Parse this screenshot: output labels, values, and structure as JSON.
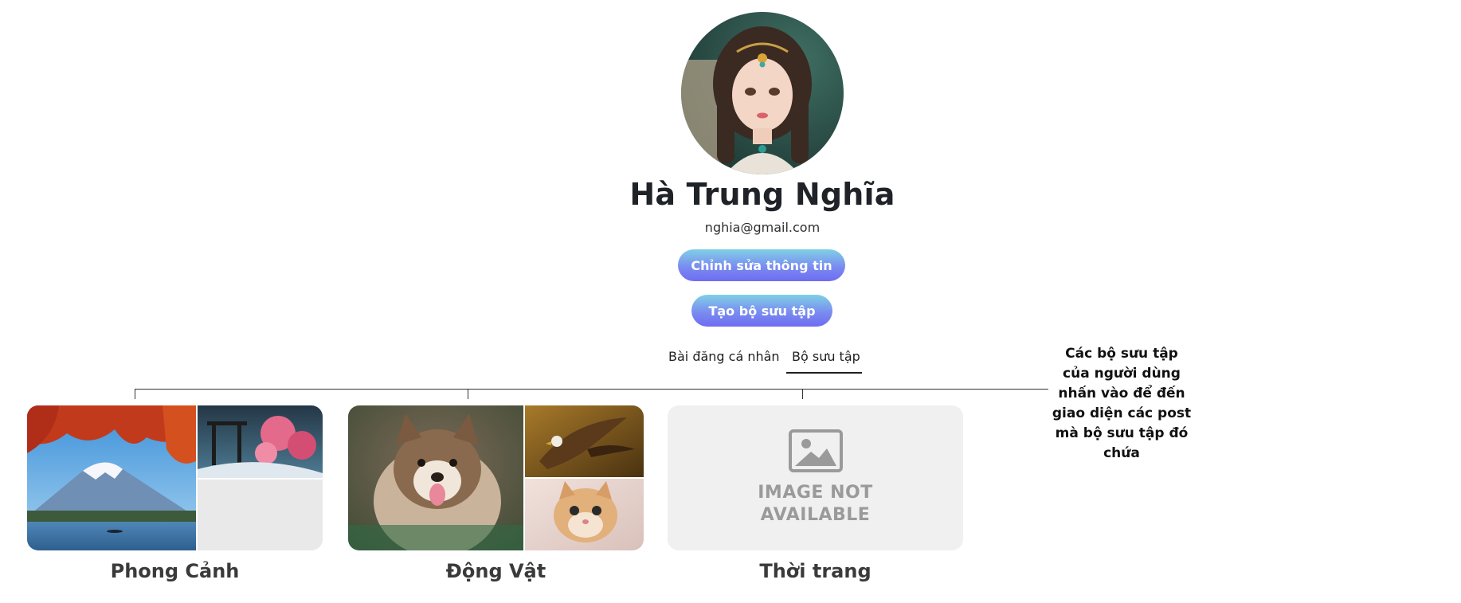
{
  "profile": {
    "name": "Hà Trung Nghĩa",
    "email": "nghia@gmail.com",
    "avatar_icon": "avatar-portrait"
  },
  "actions": {
    "edit_label": "Chỉnh sửa thông tin",
    "create_label": "Tạo bộ sưu tập"
  },
  "tabs": [
    {
      "label": "Bài đăng cá nhân",
      "active": false
    },
    {
      "label": "Bộ sưu tập",
      "active": true
    }
  ],
  "annotation": "Các bộ sưu tập của người dùng nhấn vào để đến giao diện các post mà bộ sưu tập đó chứa",
  "collections": [
    {
      "title": "Phong Cảnh",
      "thumbnails": [
        "mountain-autumn-photo",
        "torii-blossom-photo",
        "empty-slot"
      ]
    },
    {
      "title": "Động Vật",
      "thumbnails": [
        "husky-puppy-photo",
        "eagle-photo",
        "kitten-photo"
      ]
    },
    {
      "title": "Thời trang",
      "thumbnails": [
        "image-not-available"
      ],
      "placeholder_text_line1": "IMAGE NOT",
      "placeholder_text_line2": "AVAILABLE"
    }
  ],
  "colors": {
    "button_gradient_top": "#7fd0e6",
    "button_gradient_bottom": "#6f6cf2",
    "placeholder_bg": "#f0f0f0",
    "placeholder_text": "#9a9a9a"
  }
}
